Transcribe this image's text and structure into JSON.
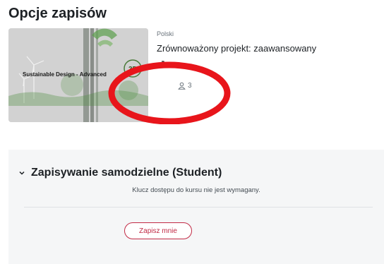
{
  "page": {
    "title": "Opcje zapisów"
  },
  "course": {
    "language": "Polski",
    "name": "Zrównoważony projekt: zaawansowany",
    "image_text": "Sustainable Design - Advanced",
    "logo_text": "3D",
    "participants": "3",
    "enrol_icon": "sign-in-icon",
    "participants_icon": "user-icon"
  },
  "enrolment": {
    "section_title": "Zapisywanie samodzielne (Student)",
    "toggle_icon": "chevron-down-icon",
    "info": "Klucz dostępu do kursu nie jest wymagany.",
    "button_label": "Zapisz mnie"
  },
  "colors": {
    "accent": "#c12a45",
    "highlight": "#e8151b",
    "panel_bg": "#f5f6f7"
  }
}
